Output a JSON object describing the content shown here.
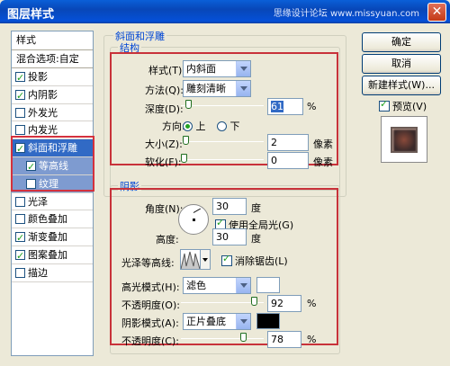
{
  "window": {
    "title": "图层样式",
    "watermark": "思缘设计论坛 www.missyuan.com"
  },
  "style_list": {
    "header": "样式",
    "blend_options": "混合选项:自定",
    "items": [
      {
        "label": "投影",
        "checked": true
      },
      {
        "label": "内阴影",
        "checked": true
      },
      {
        "label": "外发光",
        "checked": false
      },
      {
        "label": "内发光",
        "checked": false
      },
      {
        "label": "斜面和浮雕",
        "checked": true,
        "selected": true
      },
      {
        "label": "等高线",
        "checked": true,
        "sub": true
      },
      {
        "label": "纹理",
        "checked": false,
        "sub": true
      },
      {
        "label": "光泽",
        "checked": false
      },
      {
        "label": "颜色叠加",
        "checked": false
      },
      {
        "label": "渐变叠加",
        "checked": true
      },
      {
        "label": "图案叠加",
        "checked": true
      },
      {
        "label": "描边",
        "checked": false
      }
    ]
  },
  "bevel": {
    "group_title": "斜面和浮雕",
    "structure_title": "结构",
    "style_label": "样式(T):",
    "style_value": "内斜面",
    "method_label": "方法(Q):",
    "method_value": "雕刻清晰",
    "depth_label": "深度(D):",
    "depth_value": "61",
    "depth_unit": "%",
    "depth_slider": 0.06,
    "direction_label": "方向:",
    "dir_up": "上",
    "dir_down": "下",
    "direction_selected": "上",
    "size_label": "大小(Z):",
    "size_value": "2",
    "size_unit": "像素",
    "size_slider": 0.02,
    "soften_label": "软化(F):",
    "soften_value": "0",
    "soften_unit": "像素",
    "soften_slider": 0.0
  },
  "shading": {
    "title": "阴影",
    "angle_label": "角度(N):",
    "angle_value": "30",
    "angle_unit": "度",
    "global_light_label": "使用全局光(G)",
    "global_light_checked": true,
    "altitude_label": "高度:",
    "altitude_value": "30",
    "altitude_unit": "度",
    "gloss_label": "光泽等高线:",
    "antialias_label": "消除锯齿(L)",
    "antialias_checked": true,
    "highlight_label": "高光模式(H):",
    "highlight_mode": "滤色",
    "highlight_color": "#ffffff",
    "highlight_opacity_label": "不透明度(O):",
    "highlight_opacity": "92",
    "highlight_opacity_unit": "%",
    "highlight_slider": 0.92,
    "shadow_label": "阴影模式(A):",
    "shadow_mode": "正片叠底",
    "shadow_color": "#000000",
    "shadow_opacity_label": "不透明度(C):",
    "shadow_opacity": "78",
    "shadow_opacity_unit": "%",
    "shadow_slider": 0.78
  },
  "buttons": {
    "ok": "确定",
    "cancel": "取消",
    "new_style": "新建样式(W)...",
    "preview_label": "预览(V)",
    "preview_checked": true
  },
  "colors": {
    "accent": "#316ac5",
    "outline": "#c8323a",
    "group_title": "#0046d5"
  }
}
